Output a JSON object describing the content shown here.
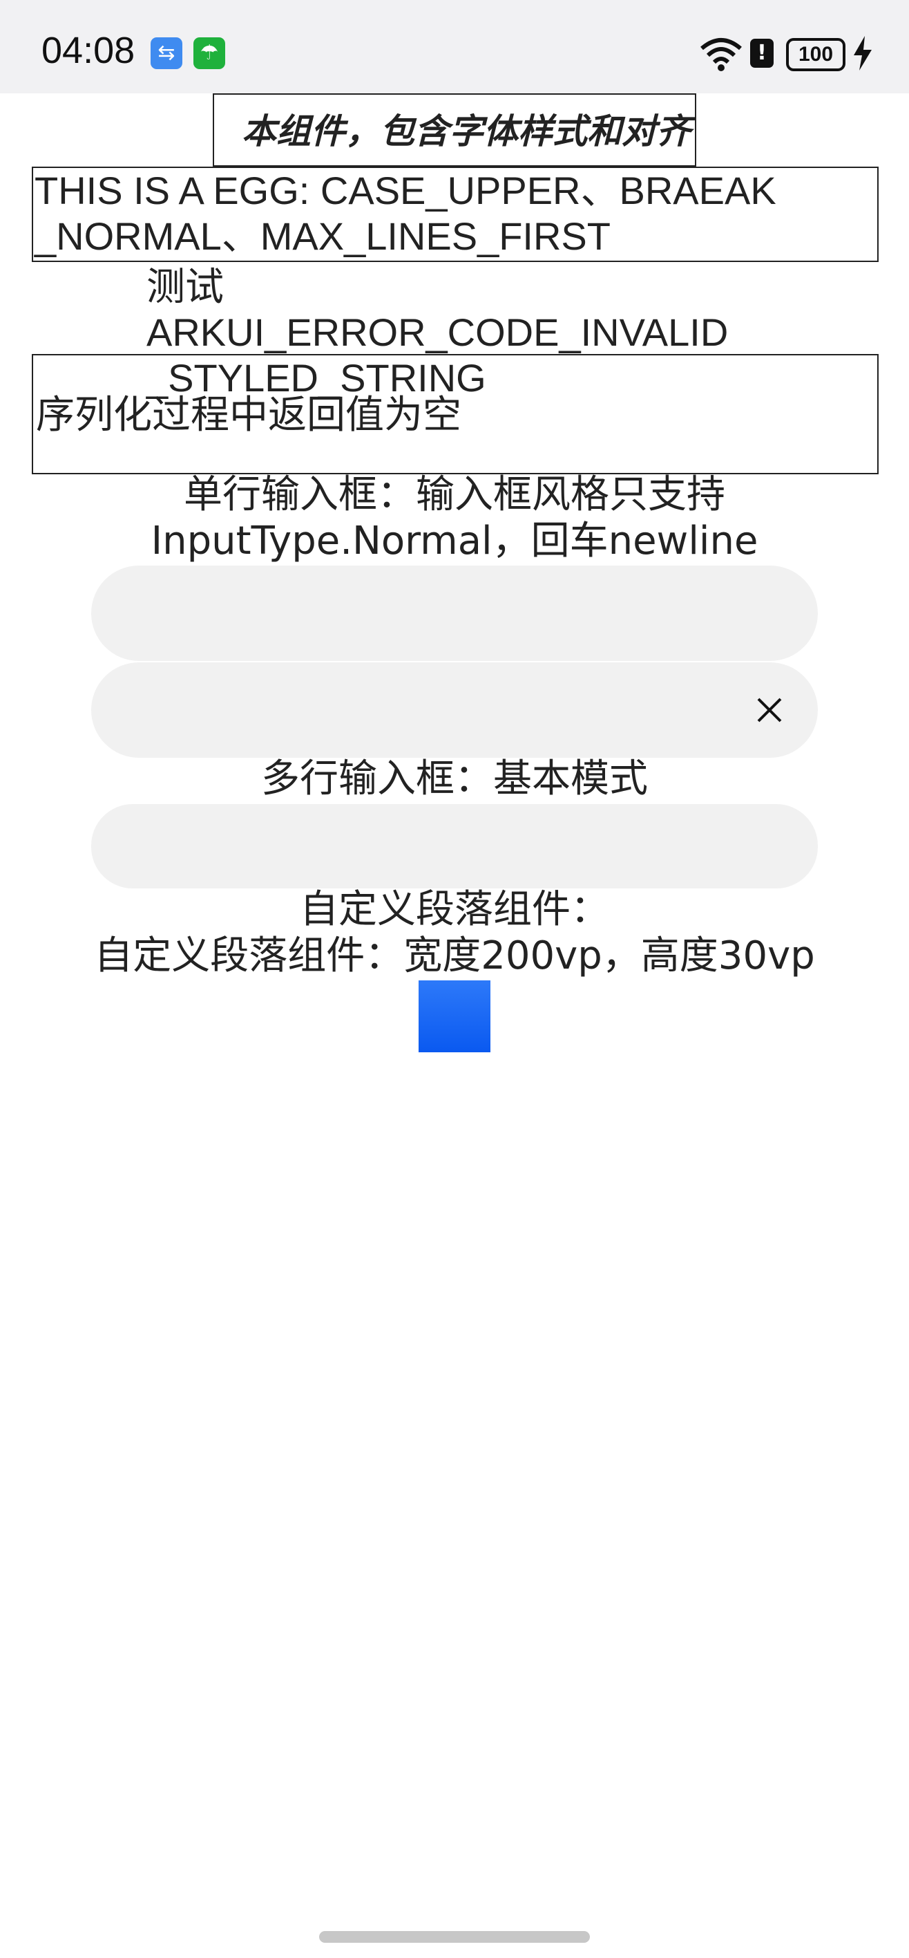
{
  "status_bar": {
    "time": "04:08",
    "battery": "100",
    "icons": [
      "usb-icon",
      "umbrella-app-icon",
      "wifi-icon",
      "alert-icon",
      "battery-icon",
      "charging-bolt-icon"
    ]
  },
  "content": {
    "title": "本组件，包含字体样式和对齐",
    "egg_line1": "THIS IS A EGG: CASE_UPPER、BRAEAK",
    "egg_line2": "_NORMAL、MAX_LINES_FIRST",
    "error_line1": "测试ARKUI_ERROR_CODE_INVALID",
    "error_line2": "_STYLED_STRING",
    "serialize_text": "序列化过程中返回值为空",
    "single_input_line1": "单行输入框：输入框风格只支持",
    "single_input_line2": "InputType.Normal，回车newline",
    "multi_input_label": "多行输入框：基本模式",
    "custom_para_label1": "自定义段落组件：",
    "custom_para_label2": "自定义段落组件：宽度200vp，高度30vp"
  },
  "colors": {
    "status_bg": "#f1f1f3",
    "input_bg": "#f1f1f1",
    "blue": "#1262f5"
  }
}
